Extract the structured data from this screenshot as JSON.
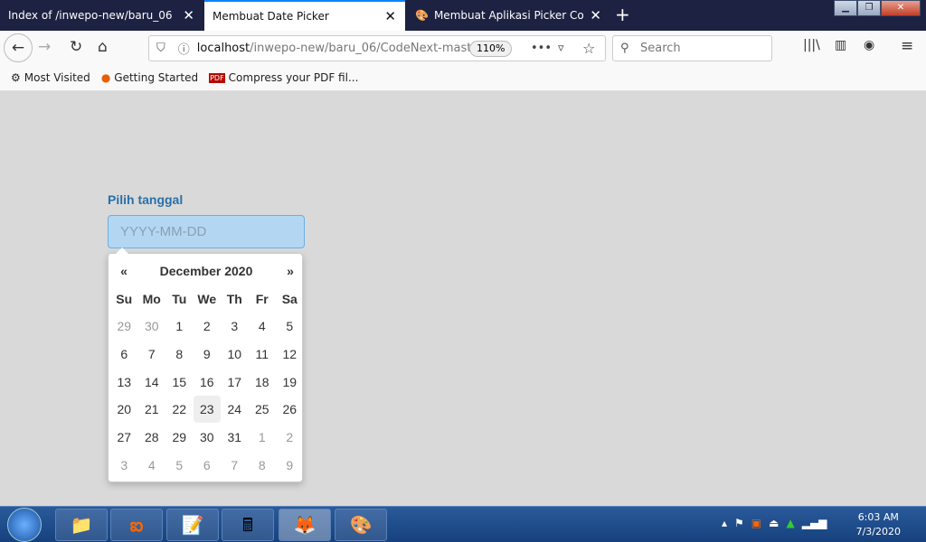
{
  "browser": {
    "tabs": [
      {
        "label": "Index of /inwepo-new/baru_06",
        "active": false
      },
      {
        "label": "Membuat Date Picker",
        "active": true
      },
      {
        "label": "Membuat Aplikasi Picker Color",
        "active": false
      }
    ],
    "url_host": "localhost",
    "url_path": "/inwepo-new/baru_06/CodeNext-mast",
    "zoom": "110%",
    "search_placeholder": "Search",
    "bookmarks": [
      "Most Visited",
      "Getting Started",
      "Compress your PDF fil..."
    ]
  },
  "page": {
    "label": "Pilih tanggal",
    "input_placeholder": "YYYY-MM-DD",
    "datepicker": {
      "prev": "«",
      "next": "»",
      "month_title": "December 2020",
      "dow": [
        "Su",
        "Mo",
        "Tu",
        "We",
        "Th",
        "Fr",
        "Sa"
      ],
      "weeks": [
        [
          "29",
          "30",
          "1",
          "2",
          "3",
          "4",
          "5"
        ],
        [
          "6",
          "7",
          "8",
          "9",
          "10",
          "11",
          "12"
        ],
        [
          "13",
          "14",
          "15",
          "16",
          "17",
          "18",
          "19"
        ],
        [
          "20",
          "21",
          "22",
          "23",
          "24",
          "25",
          "26"
        ],
        [
          "27",
          "28",
          "29",
          "30",
          "31",
          "1",
          "2"
        ],
        [
          "3",
          "4",
          "5",
          "6",
          "7",
          "8",
          "9"
        ]
      ],
      "highlighted": "23"
    }
  },
  "taskbar": {
    "time": "6:03 AM",
    "date": "7/3/2020"
  }
}
